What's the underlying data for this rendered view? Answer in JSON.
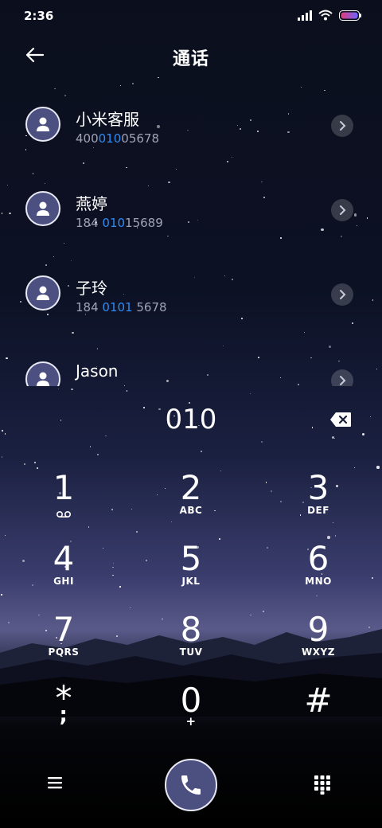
{
  "status": {
    "time": "2:36"
  },
  "header": {
    "title": "通话"
  },
  "contacts": [
    {
      "name": "小米客服",
      "number_pre": "400",
      "number_hl": "010",
      "number_post": "05678"
    },
    {
      "name": "燕婷",
      "number_pre": "184 ",
      "number_hl": "010",
      "number_post": "15689"
    },
    {
      "name": "子玲",
      "number_pre": "184 ",
      "number_hl": "0101",
      "number_post": " 5678"
    },
    {
      "name": "Jason",
      "number_pre": "",
      "number_hl": "",
      "number_post": ""
    }
  ],
  "dial": {
    "number": "010"
  },
  "keypad": [
    {
      "digit": "1",
      "letters": ""
    },
    {
      "digit": "2",
      "letters": "ABC"
    },
    {
      "digit": "3",
      "letters": "DEF"
    },
    {
      "digit": "4",
      "letters": "GHI"
    },
    {
      "digit": "5",
      "letters": "JKL"
    },
    {
      "digit": "6",
      "letters": "MNO"
    },
    {
      "digit": "7",
      "letters": "PQRS"
    },
    {
      "digit": "8",
      "letters": "TUV"
    },
    {
      "digit": "9",
      "letters": "WXYZ"
    },
    {
      "digit": "*",
      "letters": ";"
    },
    {
      "digit": "0",
      "letters": "+"
    },
    {
      "digit": "#",
      "letters": ""
    }
  ],
  "icons": {
    "back": "arrow-left-icon",
    "delete": "backspace-icon",
    "menu": "hamburger-menu-icon",
    "call": "phone-icon",
    "keypad": "dialpad-icon",
    "voicemail": "voicemail-icon"
  },
  "colors": {
    "accent": "#2f8cf2",
    "avatar": "#4c5080"
  }
}
